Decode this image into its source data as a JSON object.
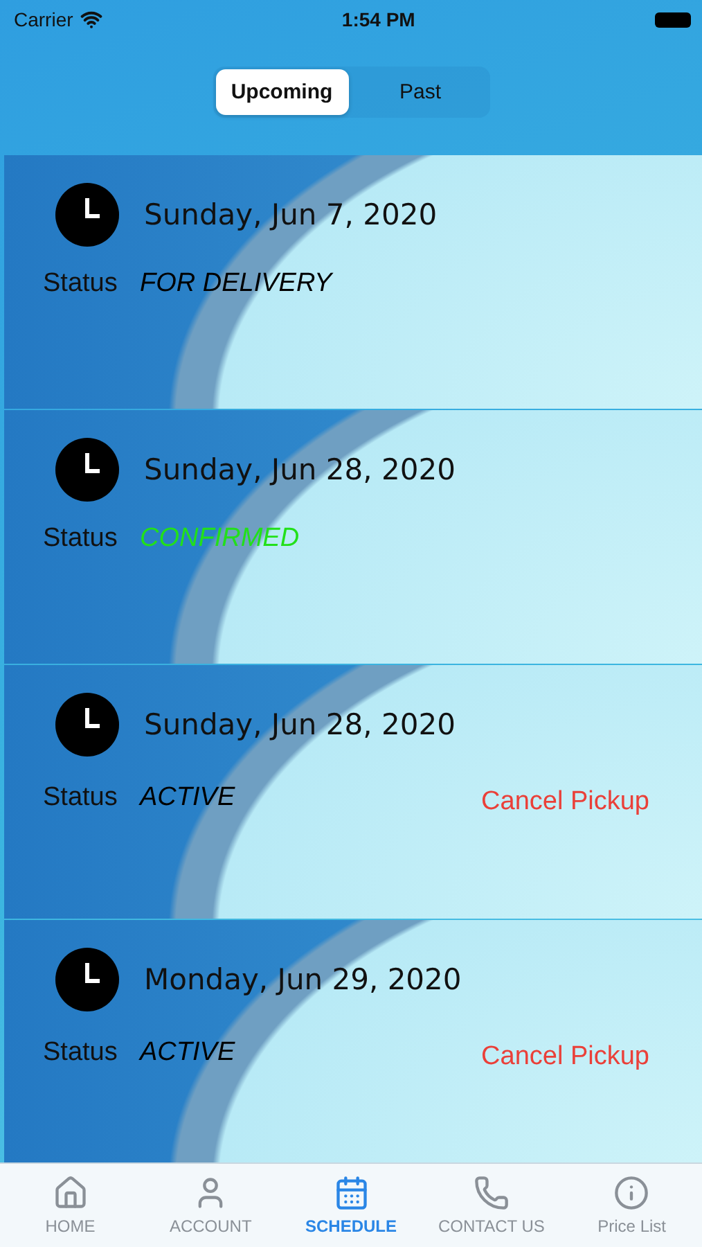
{
  "status_bar": {
    "carrier": "Carrier",
    "time": "1:54 PM"
  },
  "segments": [
    {
      "label": "Upcoming",
      "selected": true
    },
    {
      "label": "Past",
      "selected": false
    }
  ],
  "pickups": [
    {
      "date": "Sunday, Jun 7, 2020",
      "status_label": "Status",
      "status": "FOR DELIVERY",
      "color": "#000000"
    },
    {
      "date": "Sunday, Jun 28, 2020",
      "status_label": "Status",
      "status": "CONFIRMED",
      "color": "#22e01a"
    },
    {
      "date": "Sunday, Jun 28, 2020",
      "status_label": "Status",
      "status": "ACTIVE",
      "color": "#000000",
      "action": "Cancel Pickup"
    },
    {
      "date": "Monday, Jun 29, 2020",
      "status_label": "Status",
      "status": "ACTIVE",
      "color": "#000000",
      "action": "Cancel Pickup"
    }
  ],
  "tab_bar": [
    {
      "kind": "home",
      "label": "HOME",
      "selected": false
    },
    {
      "kind": "account",
      "label": "ACCOUNT",
      "selected": false
    },
    {
      "kind": "schedule",
      "label": "SCHEDULE",
      "selected": true
    },
    {
      "kind": "phone",
      "label": "CONTACT US",
      "selected": false
    },
    {
      "kind": "info",
      "label": "Price List",
      "selected": false
    }
  ]
}
